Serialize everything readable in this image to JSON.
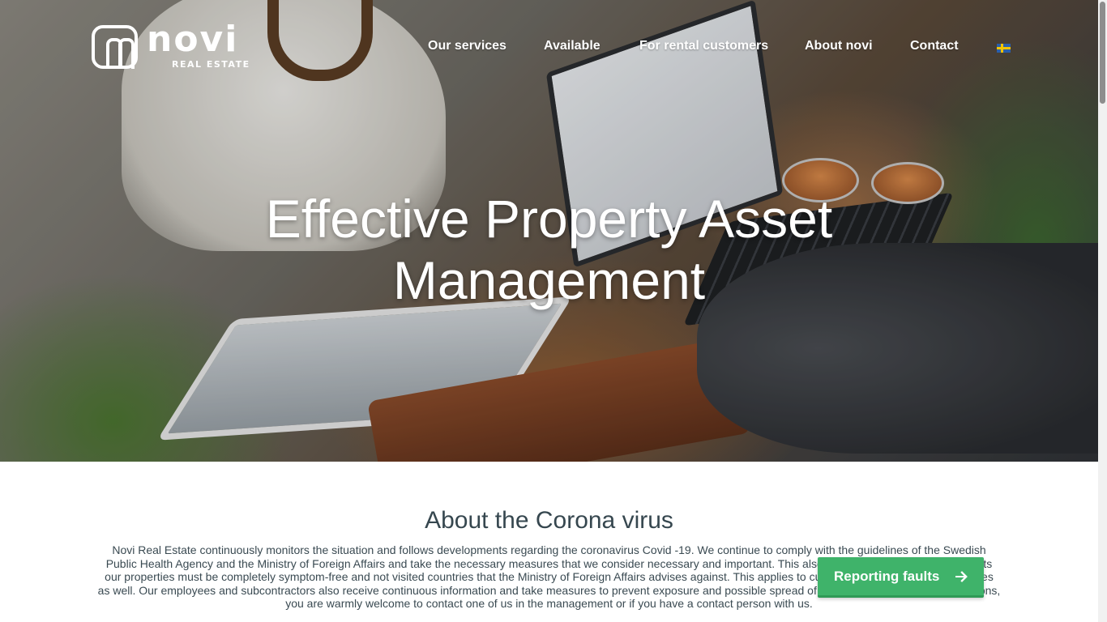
{
  "header": {
    "logo_word": "novi",
    "logo_sub": "REAL ESTATE",
    "nav": [
      {
        "label": "Our services"
      },
      {
        "label": "Available"
      },
      {
        "label": "For rental customers"
      },
      {
        "label": "About novi"
      },
      {
        "label": "Contact"
      }
    ],
    "language_icon": "swedish-flag-icon"
  },
  "hero": {
    "title": "Effective Property Asset Management"
  },
  "corona": {
    "title": "About the Corona virus",
    "text": "Novi Real Estate continuously monitors the situation and follows developments regarding the coronavirus Covid -19. We continue to comply with the guidelines of the Swedish Public Health Agency and the Ministry of Foreign Affairs and take the necessary measures that we consider necessary and important. This also includes that everyone who visits our properties must be completely symptom-free and not visited countries that the Ministry of Foreign Affairs advises against. This applies to customers, suppliers and employees as well. Our employees and subcontractors also receive continuous information and take measures to prevent exposure and possible spread of infection. If you have any questions, you are warmly welcome to contact one of us in the management or if you have a contact person with us."
  },
  "report_button": {
    "label": "Reporting faults",
    "icon": "arrow-right-icon",
    "color": "#3fb36a"
  }
}
